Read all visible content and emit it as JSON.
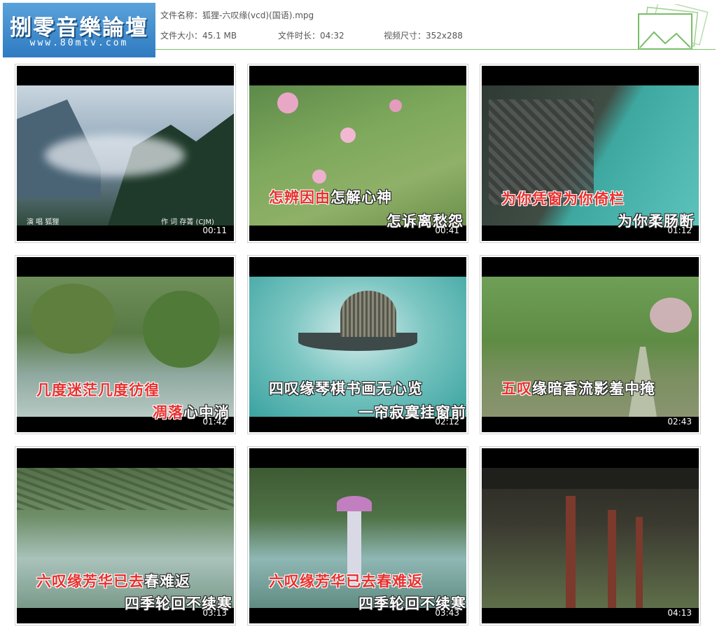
{
  "logo": {
    "title": "捌零音樂論壇",
    "url": "www.80mtv.com"
  },
  "file_info": {
    "name_label": "文件名称：",
    "name_value": "狐狸-六叹缘(vcd)(国语).mpg",
    "size_label": "文件大小：",
    "size_value": "45.1 MB",
    "duration_label": "文件时长：",
    "duration_value": "04:32",
    "dimensions_label": "视频尺寸：",
    "dimensions_value": "352x288"
  },
  "thumbnails": [
    {
      "timestamp": "00:11",
      "credit_left": "演 唱  狐狸",
      "credit_right": "作 词  存菁 (CJM)",
      "line1": "",
      "line2": ""
    },
    {
      "timestamp": "00:41",
      "line1_red": "怎辨因由",
      "line1_white": "怎解心神",
      "line2": "怎诉离愁怨"
    },
    {
      "timestamp": "01:12",
      "line1_red": "为你凭窗为你倚栏",
      "line1_white": "",
      "line2": "为你柔肠断"
    },
    {
      "timestamp": "01:42",
      "line1_red": "几度迷茫几度彷徨",
      "line1_white": "",
      "line2_red": "凋落",
      "line2_white": "心中淌"
    },
    {
      "timestamp": "02:12",
      "line1_red": "",
      "line1_white": "四叹缘琴棋书画无心览",
      "line2": "一帘寂寞挂窗前"
    },
    {
      "timestamp": "02:43",
      "line1_red": "五叹",
      "line1_white": "缘暗香流影羞中掩",
      "line2": ""
    },
    {
      "timestamp": "03:13",
      "line1_red": "六叹缘芳华已去",
      "line1_white": "春难返",
      "line2": "四季轮回不续寒"
    },
    {
      "timestamp": "03:43",
      "line1_red": "六叹缘芳华已去春难返",
      "line1_white": "",
      "line2": "四季轮回不续寒"
    },
    {
      "timestamp": "04:13",
      "line1_red": "",
      "line1_white": "",
      "line2": ""
    }
  ]
}
